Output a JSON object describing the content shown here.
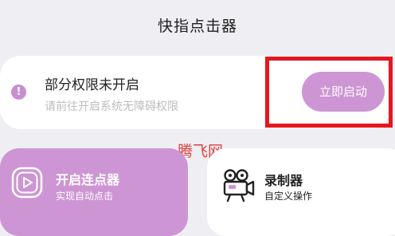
{
  "header": {
    "title": "快指点击器"
  },
  "permission": {
    "title": "部分权限未开启",
    "subtitle": "请前往开启系统无障碍权限",
    "button_label": "立即启动",
    "icon": "warning-icon"
  },
  "watermark": "腾飞网",
  "cards": {
    "connect": {
      "title": "开启连点器",
      "subtitle": "实现自动点击",
      "icon": "play-icon"
    },
    "record": {
      "title": "录制器",
      "subtitle": "自定义操作",
      "icon": "video-camera-icon"
    }
  },
  "colors": {
    "accent": "#cd95d3",
    "background": "#efeef2",
    "highlight_frame": "#e6171e",
    "watermark": "#e04040"
  }
}
